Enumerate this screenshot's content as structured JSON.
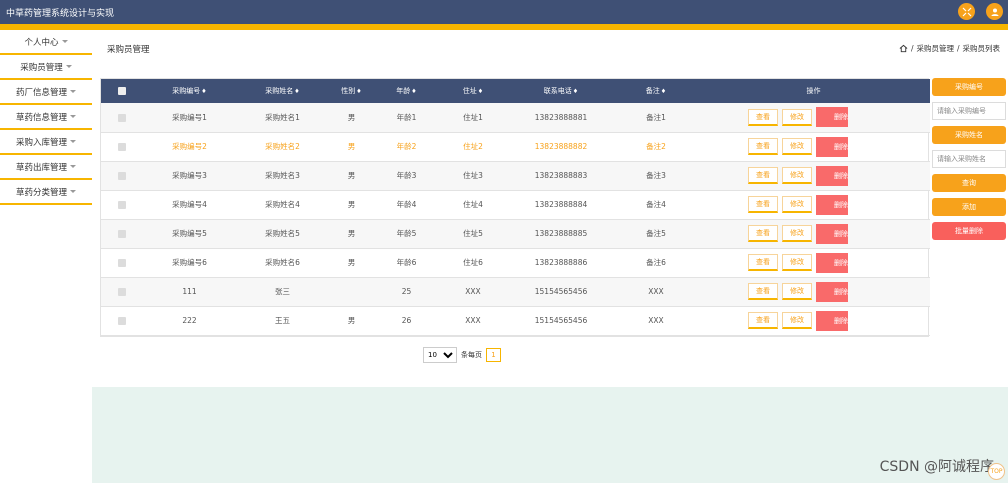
{
  "app": {
    "title": "中草药管理系统设计与实现"
  },
  "sidebar": {
    "items": [
      {
        "label": "个人中心"
      },
      {
        "label": "采购员管理"
      },
      {
        "label": "药厂信息管理"
      },
      {
        "label": "草药信息管理"
      },
      {
        "label": "采购入库管理"
      },
      {
        "label": "草药出库管理"
      },
      {
        "label": "草药分类管理"
      }
    ]
  },
  "page": {
    "title": "采购员管理",
    "breadcrumb": {
      "level1": "采购员管理",
      "level2": "采购员列表",
      "sep": "/"
    }
  },
  "table": {
    "headers": {
      "id": "采购编号",
      "name": "采购姓名",
      "gender": "性别",
      "age": "年龄",
      "address": "住址",
      "phone": "联系电话",
      "note": "备注",
      "ops": "操作"
    },
    "sort_icon": "♦",
    "actions": {
      "view": "查看",
      "edit": "修改",
      "delete": "删除"
    },
    "rows": [
      {
        "id": "采购编号1",
        "name": "采购姓名1",
        "gender": "男",
        "age": "年龄1",
        "address": "住址1",
        "phone": "13823888881",
        "note": "备注1"
      },
      {
        "id": "采购编号2",
        "name": "采购姓名2",
        "gender": "男",
        "age": "年龄2",
        "address": "住址2",
        "phone": "13823888882",
        "note": "备注2"
      },
      {
        "id": "采购编号3",
        "name": "采购姓名3",
        "gender": "男",
        "age": "年龄3",
        "address": "住址3",
        "phone": "13823888883",
        "note": "备注3"
      },
      {
        "id": "采购编号4",
        "name": "采购姓名4",
        "gender": "男",
        "age": "年龄4",
        "address": "住址4",
        "phone": "13823888884",
        "note": "备注4"
      },
      {
        "id": "采购编号5",
        "name": "采购姓名5",
        "gender": "男",
        "age": "年龄5",
        "address": "住址5",
        "phone": "13823888885",
        "note": "备注5"
      },
      {
        "id": "采购编号6",
        "name": "采购姓名6",
        "gender": "男",
        "age": "年龄6",
        "address": "住址6",
        "phone": "13823888886",
        "note": "备注6"
      },
      {
        "id": "111",
        "name": "张三",
        "gender": "",
        "age": "25",
        "address": "XXX",
        "phone": "15154565456",
        "note": "XXX"
      },
      {
        "id": "222",
        "name": "王五",
        "gender": "男",
        "age": "26",
        "address": "XXX",
        "phone": "15154565456",
        "note": "XXX"
      }
    ]
  },
  "search": {
    "id_label": "采购编号",
    "id_placeholder": "请输入采购编号",
    "name_label": "采购姓名",
    "name_placeholder": "请输入采购姓名",
    "query": "查询",
    "add": "添加",
    "batch_delete": "批量删除"
  },
  "pager": {
    "page_size": "10",
    "per_page_label": "条每页",
    "current_page": "1"
  },
  "watermark": "CSDN @阿诚程序",
  "top_button": "TOP",
  "colors": {
    "header": "#3f5075",
    "accent": "#f7b500",
    "orange": "#f7a21b",
    "danger": "#f96a6a",
    "footer": "#e7f3ef"
  }
}
